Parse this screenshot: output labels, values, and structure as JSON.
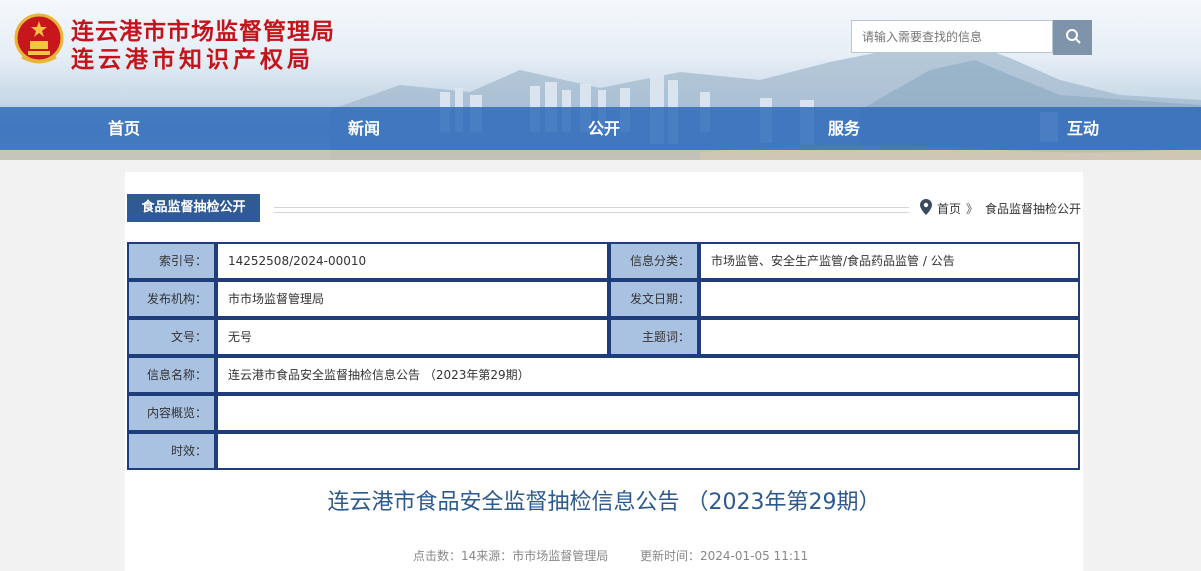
{
  "header": {
    "title_line1": "连云港市市场监督管理局",
    "title_line2": "连云港市知识产权局",
    "emblem_icon": "national-emblem-icon"
  },
  "search": {
    "placeholder": "请输入需要查找的信息",
    "button_icon": "search-icon"
  },
  "nav": {
    "items": [
      {
        "label": "首页"
      },
      {
        "label": "新闻"
      },
      {
        "label": "公开"
      },
      {
        "label": "服务"
      },
      {
        "label": "互动"
      }
    ]
  },
  "section": {
    "tab_label": "食品监督抽检公开",
    "breadcrumb_home": "首页",
    "breadcrumb_sep": "》",
    "breadcrumb_current": "食品监督抽检公开",
    "pin_icon": "location-pin-icon"
  },
  "meta": {
    "index_no_label": "索引号：",
    "index_no": "14252508/2024-00010",
    "category_label": "信息分类：",
    "category": "市场监管、安全生产监管/食品药品监管 / 公告",
    "publisher_label": "发布机构：",
    "publisher": "市市场监督管理局",
    "issue_date_label": "发文日期：",
    "issue_date": "",
    "doc_no_label": "文号：",
    "doc_no": "无号",
    "keywords_label": "主题词：",
    "keywords": "",
    "info_name_label": "信息名称：",
    "info_name": "连云港市食品安全监督抽检信息公告 （2023年第29期）",
    "summary_label": "内容概览：",
    "summary": "",
    "validity_label": "时效：",
    "validity": ""
  },
  "article": {
    "title": "连云港市食品安全监督抽检信息公告 （2023年第29期）",
    "clicks": "点击数：14来源：市市场监督管理局",
    "updated": "更新时间：2024-01-05 11:11"
  },
  "colors": {
    "title_red": "#c4141b",
    "nav_blue": "#2b68ba",
    "tab_blue": "#2f5a95",
    "label_bg": "#aac2e2",
    "border_navy": "#1f3d7a",
    "article_title": "#2d5a8e"
  }
}
